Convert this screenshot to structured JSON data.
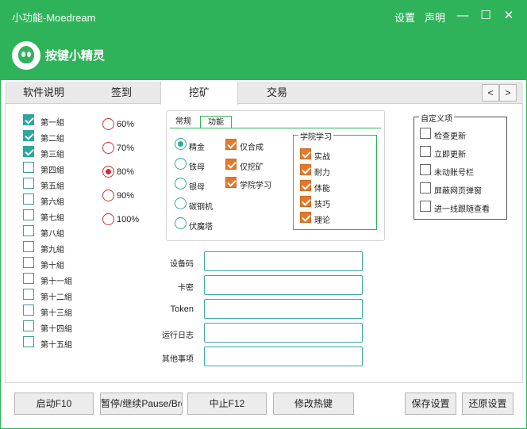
{
  "window": {
    "title": "小功能-Moedream",
    "settings_link": "设置",
    "statement_link": "声明",
    "minimize_glyph": "—",
    "maximize_glyph": "☐",
    "close_glyph": "✕",
    "accent_color": "#2fb35a"
  },
  "banner": {
    "brand": "按键小精灵"
  },
  "tabs": [
    {
      "label": "软件说明"
    },
    {
      "label": "签到"
    },
    {
      "label": "挖矿",
      "active": true
    },
    {
      "label": "交易"
    }
  ],
  "tab_nav": {
    "prev": "<",
    "next": ">"
  },
  "groups": [
    {
      "label": "第一組",
      "checked": true
    },
    {
      "label": "第二組",
      "checked": true
    },
    {
      "label": "第三組",
      "checked": true
    },
    {
      "label": "第四組",
      "checked": false
    },
    {
      "label": "第五組",
      "checked": false
    },
    {
      "label": "第六組",
      "checked": false
    },
    {
      "label": "第七組",
      "checked": false
    },
    {
      "label": "第八組",
      "checked": false
    },
    {
      "label": "第九組",
      "checked": false
    },
    {
      "label": "第十組",
      "checked": false
    },
    {
      "label": "第十一組",
      "checked": false
    },
    {
      "label": "第十二組",
      "checked": false
    },
    {
      "label": "第十三組",
      "checked": false
    },
    {
      "label": "第十四組",
      "checked": false
    },
    {
      "label": "第十五組",
      "checked": false
    }
  ],
  "percent_options": [
    {
      "label": "60%",
      "selected": false
    },
    {
      "label": "70%",
      "selected": false
    },
    {
      "label": "80%",
      "selected": true
    },
    {
      "label": "90%",
      "selected": false
    },
    {
      "label": "100%",
      "selected": false
    }
  ],
  "subtabs": [
    {
      "label": "常规"
    },
    {
      "label": "功能",
      "active": true
    }
  ],
  "ore_options": [
    {
      "label": "精金",
      "selected": true
    },
    {
      "label": "铁母",
      "selected": false
    },
    {
      "label": "银母",
      "selected": false
    },
    {
      "label": "碳钢机",
      "selected": false
    },
    {
      "label": "伏魔塔",
      "selected": false
    }
  ],
  "function_checks": [
    {
      "label": "仅合成",
      "checked": true
    },
    {
      "label": "仅挖矿",
      "checked": true
    },
    {
      "label": "学院学习",
      "checked": true
    }
  ],
  "academy": {
    "title": "学院学习",
    "items": [
      {
        "label": "实战",
        "checked": true
      },
      {
        "label": "耐力",
        "checked": true
      },
      {
        "label": "体能",
        "checked": true
      },
      {
        "label": "技巧",
        "checked": true
      },
      {
        "label": "理论",
        "checked": true
      }
    ]
  },
  "fields": [
    {
      "label": "设备码",
      "value": ""
    },
    {
      "label": "卡密",
      "value": ""
    },
    {
      "label": "Token",
      "value": ""
    },
    {
      "label": "运行日志",
      "value": ""
    },
    {
      "label": "其他事项",
      "value": ""
    }
  ],
  "custom": {
    "title": "自定义项",
    "items": [
      {
        "label": "检查更新",
        "checked": false
      },
      {
        "label": "立即更新",
        "checked": false
      },
      {
        "label": "未动账号栏",
        "checked": false
      },
      {
        "label": "屏蔽网页弹窗",
        "checked": false
      },
      {
        "label": "进一线跟随查看",
        "checked": false
      }
    ]
  },
  "buttons": {
    "start": "启动F10",
    "pause": "暂停/继续Pause/Break",
    "stop": "中止F12",
    "hotkey": "修改热键",
    "save": "保存设置",
    "restore": "还原设置"
  }
}
